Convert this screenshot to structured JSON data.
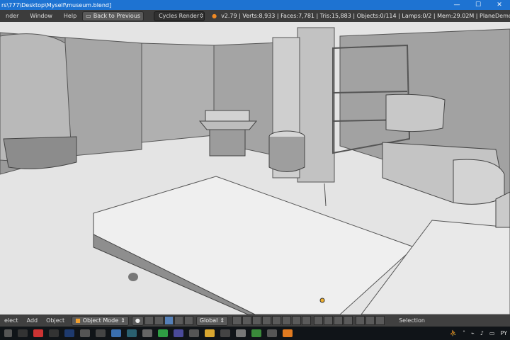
{
  "window": {
    "title": "rs\\777\\Desktop\\Myself\\museum.blend]",
    "minimize_glyph": "—",
    "maximize_glyph": "☐",
    "close_glyph": "✕"
  },
  "info_header": {
    "menus": [
      "nder",
      "Window",
      "Help"
    ],
    "back_button": "Back to Previous",
    "render_engine": "Cycles Render",
    "stats": "v2.79 | Verts:8,933 | Faces:7,781 | Tris:15,883 | Objects:0/114 | Lamps:0/2 | Mem:29.02M | Plane",
    "demo_mode": "Demo Mode"
  },
  "view3d_header": {
    "menus": [
      "elect",
      "Add",
      "Object"
    ],
    "mode": "Object Mode",
    "orientation": "Global",
    "selection_label": "Selection"
  },
  "taskbar": {
    "lang": "PY"
  },
  "colors": {
    "title_bar": "#1e73d2",
    "header_bg": "#3c3c3c",
    "viewport_bg": "#e3e3e3",
    "taskbar_bg": "#101418",
    "accent_blue": "#5580b8"
  }
}
